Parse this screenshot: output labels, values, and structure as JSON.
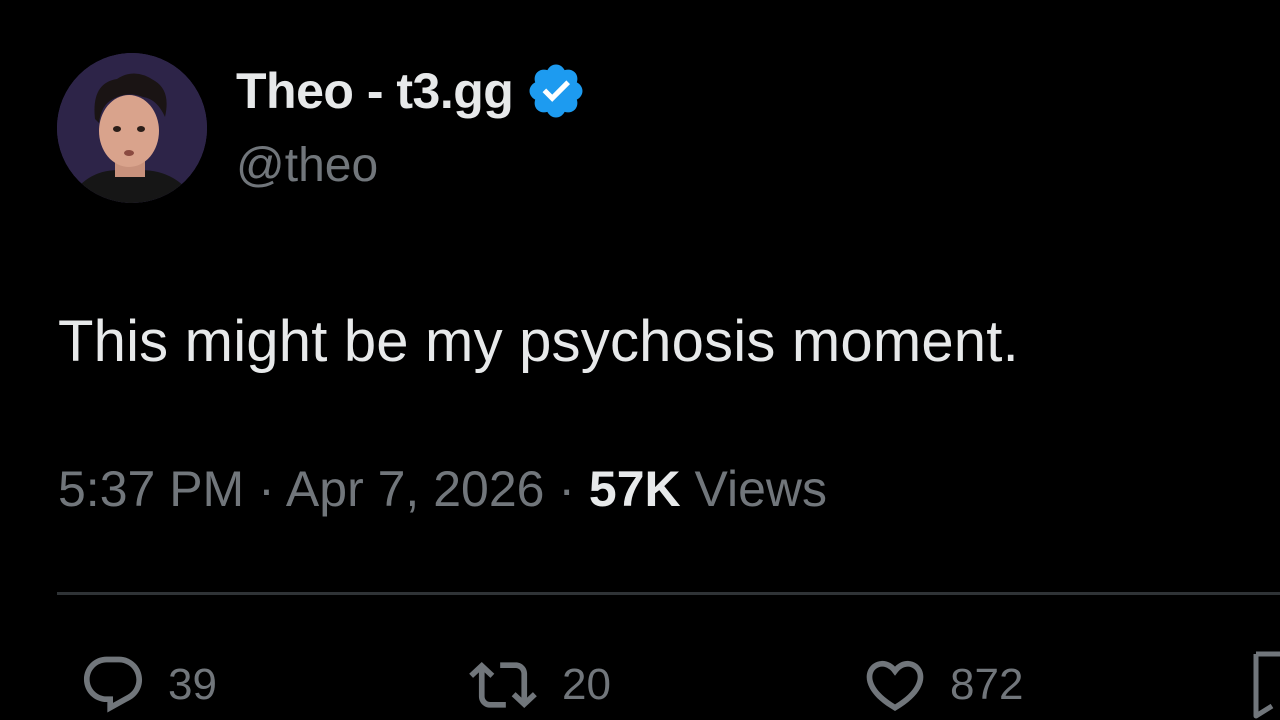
{
  "tweet": {
    "author": {
      "display_name": "Theo - t3.gg",
      "handle": "@theo",
      "verified": true,
      "avatar_icon": "profile-photo"
    },
    "text": "This might be my psychosis moment.",
    "meta": {
      "time": "5:37 PM",
      "separator": "·",
      "date": "Apr 7, 2026",
      "views_count": "57K",
      "views_label": "Views"
    },
    "actions": {
      "reply_count": "39",
      "retweet_count": "20",
      "like_count": "872"
    }
  },
  "colors": {
    "background": "#000000",
    "primary_text": "#e7e9ea",
    "secondary_text": "#71767b",
    "divider": "#2f3336",
    "verified_blue": "#1d9bf0"
  }
}
